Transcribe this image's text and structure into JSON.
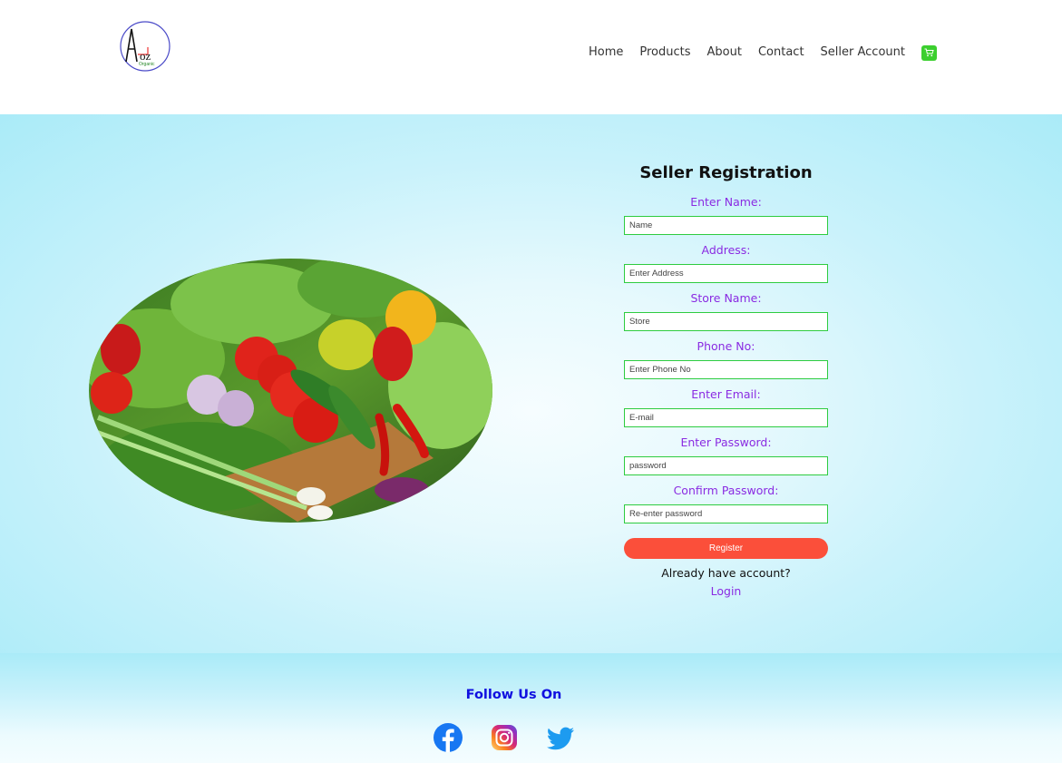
{
  "logo": {
    "text": "AtoZ",
    "tagline": "Organic"
  },
  "nav": {
    "items": [
      "Home",
      "Products",
      "About",
      "Contact",
      "Seller Account"
    ],
    "cart_icon": "cart-icon",
    "cart_color": "#3ccf2f"
  },
  "form": {
    "title": "Seller Registration",
    "fields": [
      {
        "label": "Enter Name:",
        "placeholder": "Name"
      },
      {
        "label": "Address:",
        "placeholder": "Enter Address"
      },
      {
        "label": "Store Name:",
        "placeholder": "Store"
      },
      {
        "label": "Phone No:",
        "placeholder": "Enter Phone No"
      },
      {
        "label": "Enter Email:",
        "placeholder": "E-mail"
      },
      {
        "label": "Enter Password:",
        "placeholder": "password"
      },
      {
        "label": "Confirm Password:",
        "placeholder": "Re-enter password"
      }
    ],
    "register_label": "Register",
    "already_text": "Already have account?",
    "login_label": "Login"
  },
  "footer": {
    "follow_text": "Follow Us On",
    "social_icons": [
      "facebook-icon",
      "instagram-icon",
      "twitter-icon"
    ]
  },
  "colors": {
    "accent_purple": "#8a2be2",
    "field_border": "#2ecc40",
    "register_button": "#fb4f3a",
    "follow_text": "#1010e0",
    "background_cyan": "#aaebf8"
  }
}
